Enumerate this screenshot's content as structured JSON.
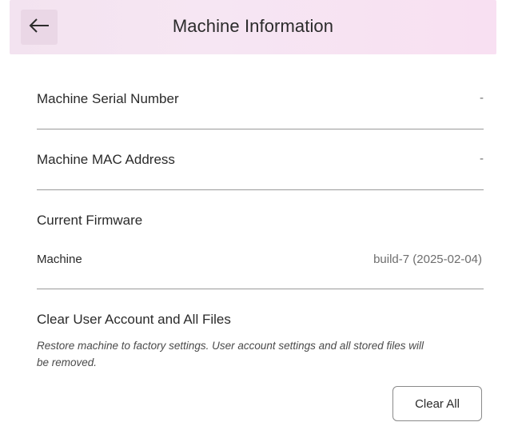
{
  "header": {
    "title": "Machine Information",
    "back_icon": "arrow-left-icon"
  },
  "serial": {
    "label": "Machine Serial Number",
    "value": "-"
  },
  "mac": {
    "label": "Machine MAC Address",
    "value": "-"
  },
  "firmware": {
    "heading": "Current Firmware",
    "item_label": "Machine",
    "item_value": "build-7 (2025-02-04)"
  },
  "reset": {
    "heading": "Clear User Account and All Files",
    "description": "Restore machine to factory settings. User account settings and all stored files will be removed.",
    "button_label": "Clear All"
  },
  "colors": {
    "header_bg": "#f6e6f3",
    "back_button_bg": "#ead7e6",
    "divider": "#9a9a9a"
  }
}
